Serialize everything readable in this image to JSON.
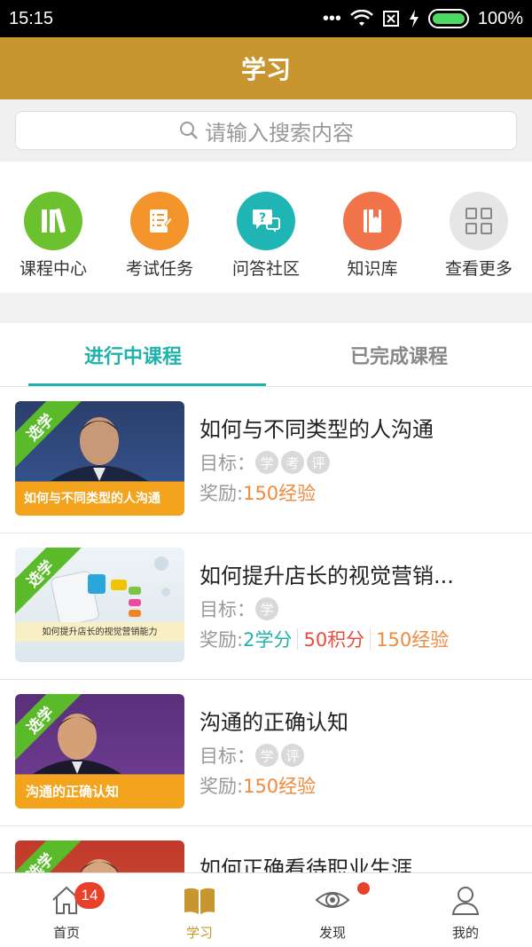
{
  "status_bar": {
    "time": "15:15",
    "battery": "100%"
  },
  "header": {
    "title": "学习"
  },
  "search": {
    "placeholder": "请输入搜索内容"
  },
  "quick_menu": [
    {
      "label": "课程中心",
      "icon": "books-icon",
      "color": "#6cc12f"
    },
    {
      "label": "考试任务",
      "icon": "checklist-icon",
      "color": "#f3952a"
    },
    {
      "label": "问答社区",
      "icon": "question-chat-icon",
      "color": "#1fb5b5"
    },
    {
      "label": "知识库",
      "icon": "book-icon",
      "color": "#f0734a"
    },
    {
      "label": "查看更多",
      "icon": "grid-icon",
      "color": "#e6e6e6"
    }
  ],
  "tabs": [
    {
      "label": "进行中课程",
      "active": true
    },
    {
      "label": "已完成课程",
      "active": false
    }
  ],
  "courses": [
    {
      "badge": "选学",
      "title": "如何与不同类型的人沟通",
      "goal_label": "目标：",
      "goal_tags": [
        "学",
        "考",
        "评"
      ],
      "reward_label": "奖励:",
      "rewards": [
        {
          "text": "150经验",
          "color": "orange"
        }
      ],
      "thumb_caption": "如何与不同类型的人沟通"
    },
    {
      "badge": "选学",
      "title": "如何提升店长的视觉营销...",
      "goal_label": "目标：",
      "goal_tags": [
        "学"
      ],
      "reward_label": "奖励:",
      "rewards": [
        {
          "text": "2学分",
          "color": "teal"
        },
        {
          "text": "50积分",
          "color": "red"
        },
        {
          "text": "150经验",
          "color": "orange"
        }
      ],
      "thumb_caption": "如何提升店长的视觉营销能力"
    },
    {
      "badge": "选学",
      "title": "沟通的正确认知",
      "goal_label": "目标：",
      "goal_tags": [
        "学",
        "评"
      ],
      "reward_label": "奖励:",
      "rewards": [
        {
          "text": "150经验",
          "color": "orange"
        }
      ],
      "thumb_caption": "沟通的正确认知"
    },
    {
      "badge": "选学",
      "title": "如何正确看待职业生涯",
      "goal_label": "",
      "goal_tags": [],
      "reward_label": "",
      "rewards": [],
      "thumb_caption": ""
    }
  ],
  "bottom_nav": [
    {
      "label": "首页",
      "icon": "home-icon",
      "badge": "14"
    },
    {
      "label": "学习",
      "icon": "open-book-icon",
      "active": true
    },
    {
      "label": "发现",
      "icon": "eye-icon",
      "dot": true
    },
    {
      "label": "我的",
      "icon": "person-icon"
    }
  ]
}
